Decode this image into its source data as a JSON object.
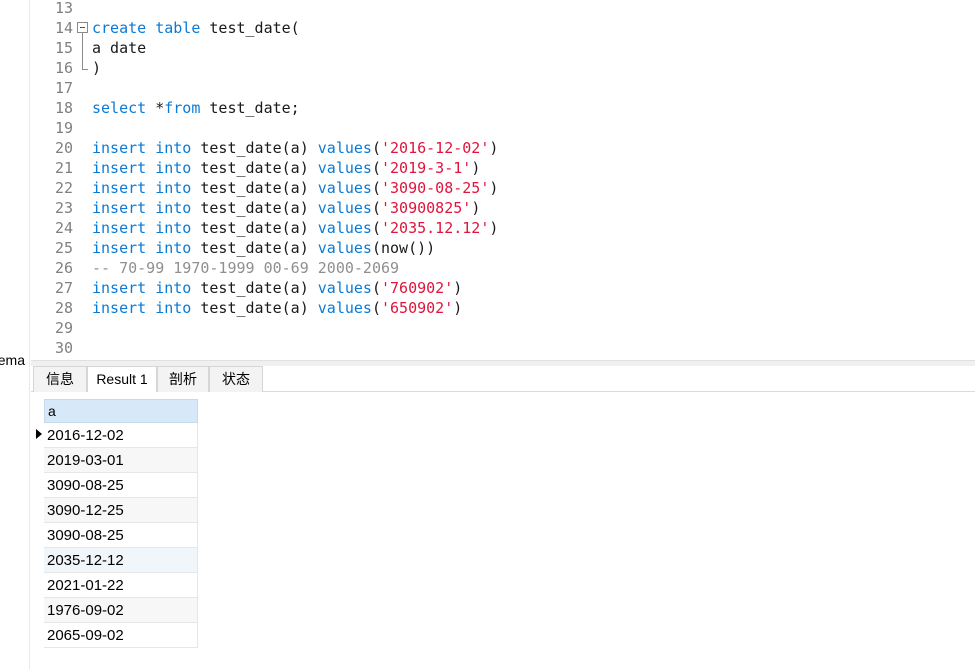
{
  "sidebar": {
    "label": "ema"
  },
  "editor": {
    "lines": [
      {
        "n": "13",
        "tokens": []
      },
      {
        "n": "14",
        "fold": "start",
        "tokens": [
          [
            "kw",
            "create"
          ],
          [
            "pl",
            " "
          ],
          [
            "kw",
            "table"
          ],
          [
            "pl",
            " test_date("
          ]
        ]
      },
      {
        "n": "15",
        "tokens": [
          [
            "pl",
            "a date"
          ]
        ]
      },
      {
        "n": "16",
        "fold": "end",
        "tokens": [
          [
            "pl",
            ")"
          ]
        ]
      },
      {
        "n": "17",
        "tokens": []
      },
      {
        "n": "18",
        "tokens": [
          [
            "kw",
            "select"
          ],
          [
            "pl",
            " *"
          ],
          [
            "kw",
            "from"
          ],
          [
            "pl",
            " test_date;"
          ]
        ]
      },
      {
        "n": "19",
        "tokens": []
      },
      {
        "n": "20",
        "tokens": [
          [
            "kw",
            "insert"
          ],
          [
            "pl",
            " "
          ],
          [
            "kw",
            "into"
          ],
          [
            "pl",
            " test_date(a) "
          ],
          [
            "kw",
            "values"
          ],
          [
            "pl",
            "("
          ],
          [
            "str",
            "'2016-12-02'"
          ],
          [
            "pl",
            ")"
          ]
        ]
      },
      {
        "n": "21",
        "tokens": [
          [
            "kw",
            "insert"
          ],
          [
            "pl",
            " "
          ],
          [
            "kw",
            "into"
          ],
          [
            "pl",
            " test_date(a) "
          ],
          [
            "kw",
            "values"
          ],
          [
            "pl",
            "("
          ],
          [
            "str",
            "'2019-3-1'"
          ],
          [
            "pl",
            ")"
          ]
        ]
      },
      {
        "n": "22",
        "tokens": [
          [
            "kw",
            "insert"
          ],
          [
            "pl",
            " "
          ],
          [
            "kw",
            "into"
          ],
          [
            "pl",
            " test_date(a) "
          ],
          [
            "kw",
            "values"
          ],
          [
            "pl",
            "("
          ],
          [
            "str",
            "'3090-08-25'"
          ],
          [
            "pl",
            ")"
          ]
        ]
      },
      {
        "n": "23",
        "tokens": [
          [
            "kw",
            "insert"
          ],
          [
            "pl",
            " "
          ],
          [
            "kw",
            "into"
          ],
          [
            "pl",
            " test_date(a) "
          ],
          [
            "kw",
            "values"
          ],
          [
            "pl",
            "("
          ],
          [
            "str",
            "'30900825'"
          ],
          [
            "pl",
            ")"
          ]
        ]
      },
      {
        "n": "24",
        "tokens": [
          [
            "kw",
            "insert"
          ],
          [
            "pl",
            " "
          ],
          [
            "kw",
            "into"
          ],
          [
            "pl",
            " test_date(a) "
          ],
          [
            "kw",
            "values"
          ],
          [
            "pl",
            "("
          ],
          [
            "str",
            "'2035.12.12'"
          ],
          [
            "pl",
            ")"
          ]
        ]
      },
      {
        "n": "25",
        "tokens": [
          [
            "kw",
            "insert"
          ],
          [
            "pl",
            " "
          ],
          [
            "kw",
            "into"
          ],
          [
            "pl",
            " test_date(a) "
          ],
          [
            "kw",
            "values"
          ],
          [
            "pl",
            "(now())"
          ]
        ]
      },
      {
        "n": "26",
        "tokens": [
          [
            "cm",
            "-- 70-99 1970-1999 00-69 2000-2069"
          ]
        ]
      },
      {
        "n": "27",
        "tokens": [
          [
            "kw",
            "insert"
          ],
          [
            "pl",
            " "
          ],
          [
            "kw",
            "into"
          ],
          [
            "pl",
            " test_date(a) "
          ],
          [
            "kw",
            "values"
          ],
          [
            "pl",
            "("
          ],
          [
            "str",
            "'760902'"
          ],
          [
            "pl",
            ")"
          ]
        ]
      },
      {
        "n": "28",
        "tokens": [
          [
            "kw",
            "insert"
          ],
          [
            "pl",
            " "
          ],
          [
            "kw",
            "into"
          ],
          [
            "pl",
            " test_date(a) "
          ],
          [
            "kw",
            "values"
          ],
          [
            "pl",
            "("
          ],
          [
            "str",
            "'650902'"
          ],
          [
            "pl",
            ")"
          ]
        ]
      },
      {
        "n": "29",
        "tokens": []
      },
      {
        "n": "30",
        "tokens": []
      }
    ]
  },
  "tabs": [
    {
      "label": "信息",
      "active": false
    },
    {
      "label": "Result 1",
      "active": true
    },
    {
      "label": "剖析",
      "active": false
    },
    {
      "label": "状态",
      "active": false
    }
  ],
  "result": {
    "column": "a",
    "rows": [
      "2016-12-02",
      "2019-03-01",
      "3090-08-25",
      "3090-12-25",
      "3090-08-25",
      "2035-12-12",
      "2021-01-22",
      "1976-09-02",
      "2065-09-02"
    ]
  },
  "colors": {
    "keyword": "#0a7ad6",
    "string": "#e0143c",
    "comment": "#8f8f8f",
    "header": "#d7e8f8"
  }
}
